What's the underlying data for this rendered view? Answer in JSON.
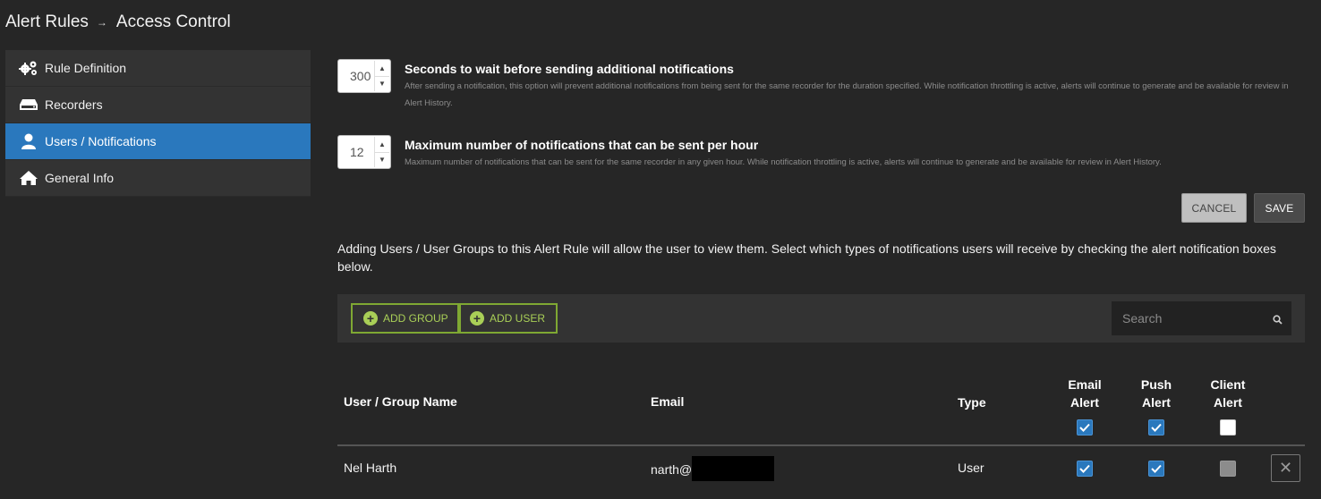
{
  "breadcrumb": {
    "root": "Alert Rules",
    "separator": "→",
    "current": "Access Control"
  },
  "sidebar": {
    "items": [
      {
        "label": "Rule Definition",
        "icon": "gears-icon",
        "active": false
      },
      {
        "label": "Recorders",
        "icon": "recorder-icon",
        "active": false
      },
      {
        "label": "Users / Notifications",
        "icon": "user-icon",
        "active": true
      },
      {
        "label": "General Info",
        "icon": "home-icon",
        "active": false
      }
    ]
  },
  "settings": {
    "wait": {
      "value": "300",
      "title": "Seconds to wait before sending additional notifications",
      "description": "After sending a notification, this option will prevent additional notifications from being sent for the same recorder for the duration specified. While notification throttling is active, alerts will continue to generate and be available for review in Alert History."
    },
    "max": {
      "value": "12",
      "title": "Maximum number of notifications that can be sent per hour",
      "description": "Maximum number of notifications that can be sent for the same recorder in any given hour. While notification throttling is active, alerts will continue to generate and be available for review in Alert History."
    }
  },
  "actions": {
    "cancel": "CANCEL",
    "save": "SAVE"
  },
  "info": "Adding Users / User Groups to this Alert Rule will allow the user to view them. Select which types of notifications users will receive by checking the alert notification boxes below.",
  "toolbar": {
    "add_group": "ADD GROUP",
    "add_user": "ADD USER",
    "search_placeholder": "Search"
  },
  "table": {
    "headers": {
      "name": "User / Group Name",
      "email": "Email",
      "type": "Type",
      "email_alert": [
        "Email",
        "Alert"
      ],
      "push_alert": [
        "Push",
        "Alert"
      ],
      "client_alert": [
        "Client",
        "Alert"
      ]
    },
    "select_all": {
      "email_alert": true,
      "push_alert": true,
      "client_alert": false
    },
    "rows": [
      {
        "name": "Nel Harth",
        "email": "narth@",
        "type": "User",
        "email_alert": true,
        "push_alert": true,
        "client_alert": "disabled"
      }
    ]
  },
  "colors": {
    "accent": "#2a78bd",
    "add_button": "#7fa833",
    "background": "#262626",
    "panel": "#333333"
  }
}
